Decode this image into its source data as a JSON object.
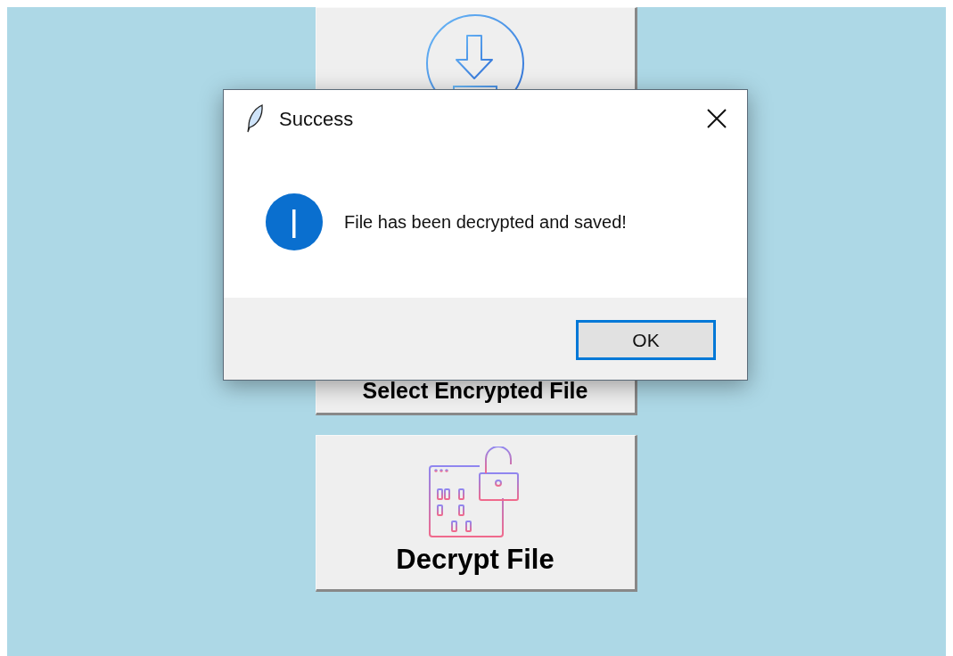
{
  "main_buttons": [
    {
      "kind": "select",
      "label": "Select Encrypted File"
    },
    {
      "kind": "decrypt",
      "label": "Decrypt File"
    }
  ],
  "dialog": {
    "title": "Success",
    "message": "File has been decrypted and saved!",
    "button": "OK"
  }
}
